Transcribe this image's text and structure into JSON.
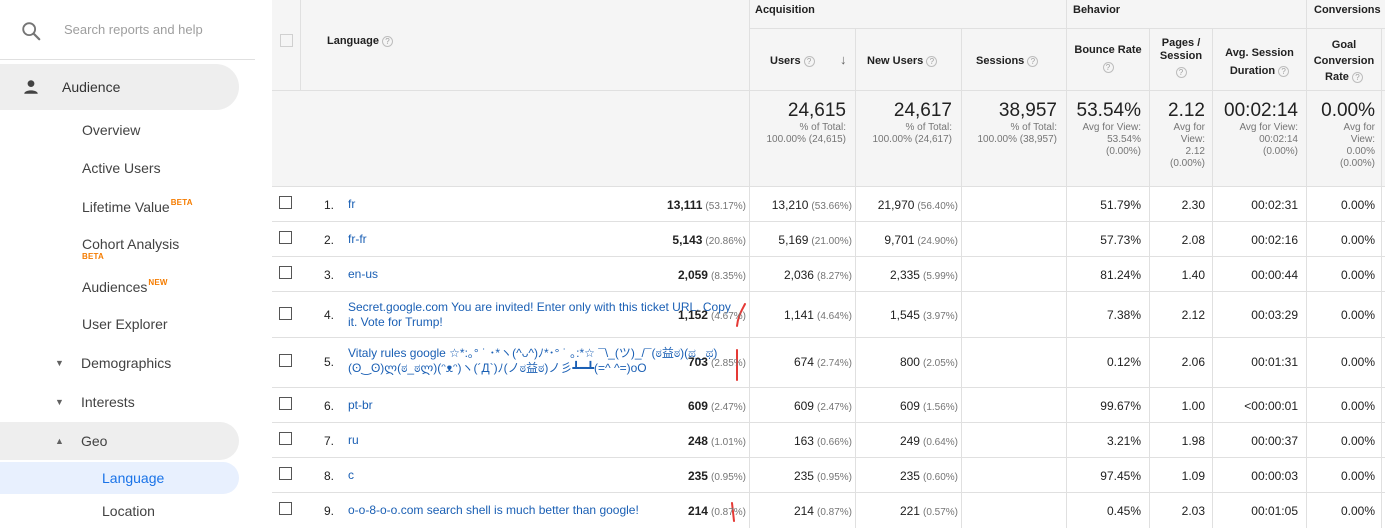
{
  "search": {
    "placeholder": "Search reports and help",
    "icon": "search-icon"
  },
  "sidebar": {
    "audience": "Audience",
    "items": [
      {
        "label": "Overview"
      },
      {
        "label": "Active Users"
      },
      {
        "label": "Lifetime Value",
        "badge": "BETA"
      },
      {
        "label": "Cohort Analysis",
        "badge": "BETA"
      },
      {
        "label": "Audiences",
        "badge": "NEW"
      },
      {
        "label": "User Explorer"
      }
    ],
    "sections": [
      {
        "label": "Demographics",
        "arrow": "▼"
      },
      {
        "label": "Interests",
        "arrow": "▼"
      },
      {
        "label": "Geo",
        "arrow": "▲"
      }
    ],
    "geo_children": [
      {
        "label": "Language",
        "selected": true
      },
      {
        "label": "Location"
      }
    ]
  },
  "table": {
    "groups": {
      "acquisition": "Acquisition",
      "behavior": "Behavior",
      "conversions": "Conversions"
    },
    "headers": {
      "language": "Language",
      "users": "Users",
      "new_users": "New Users",
      "sessions": "Sessions",
      "bounce_rate": "Bounce Rate",
      "pages_session_1": "Pages /",
      "pages_session_2": "Session",
      "avg_duration_1": "Avg. Session",
      "avg_duration_2": "Duration",
      "goal_1": "Goal",
      "goal_2": "Conversion",
      "goal_3": "Rate",
      "help": "?",
      "sort_arrow": "↓"
    },
    "totals": {
      "users": {
        "value": "24,615",
        "l1": "% of Total:",
        "l2": "100.00% (24,615)"
      },
      "new_users": {
        "value": "24,617",
        "l1": "% of Total:",
        "l2": "100.00% (24,617)"
      },
      "sessions": {
        "value": "38,957",
        "l1": "% of Total:",
        "l2": "100.00% (38,957)"
      },
      "bounce_rate": {
        "value": "53.54%",
        "l1": "Avg for View:",
        "l2": "53.54%",
        "l3": "(0.00%)"
      },
      "pages": {
        "value": "2.12",
        "l1": "Avg for",
        "l2": "View:",
        "l3": "2.12",
        "l4": "(0.00%)"
      },
      "duration": {
        "value": "00:02:14",
        "l1": "Avg for View:",
        "l2": "00:02:14",
        "l3": "(0.00%)"
      },
      "goal": {
        "value": "0.00%",
        "l1": "Avg for",
        "l2": "View:",
        "l3": "0.00%",
        "l4": "(0.00%)"
      }
    },
    "rows": [
      {
        "n": "1.",
        "lang": "fr",
        "users": "13,111",
        "users_pct": "(53.17%)",
        "new": "13,210",
        "new_pct": "(53.66%)",
        "sessions": "21,970",
        "sessions_pct": "(56.40%)",
        "bounce": "51.79%",
        "pages": "2.30",
        "dur": "00:02:31",
        "goal": "0.00%"
      },
      {
        "n": "2.",
        "lang": "fr-fr",
        "users": "5,143",
        "users_pct": "(20.86%)",
        "new": "5,169",
        "new_pct": "(21.00%)",
        "sessions": "9,701",
        "sessions_pct": "(24.90%)",
        "bounce": "57.73%",
        "pages": "2.08",
        "dur": "00:02:16",
        "goal": "0.00%"
      },
      {
        "n": "3.",
        "lang": "en-us",
        "users": "2,059",
        "users_pct": "(8.35%)",
        "new": "2,036",
        "new_pct": "(8.27%)",
        "sessions": "2,335",
        "sessions_pct": "(5.99%)",
        "bounce": "81.24%",
        "pages": "1.40",
        "dur": "00:00:44",
        "goal": "0.00%"
      },
      {
        "n": "4.",
        "lang": "Secret.google.com You are invited! Enter only with this ticket URL. Copy it. Vote for Trump!",
        "users": "1,152",
        "users_pct": "(4.67%)",
        "new": "1,141",
        "new_pct": "(4.64%)",
        "sessions": "1,545",
        "sessions_pct": "(3.97%)",
        "bounce": "7.38%",
        "pages": "2.12",
        "dur": "00:03:29",
        "goal": "0.00%"
      },
      {
        "n": "5.",
        "lang": "Vitaly rules google ☆*:｡° ˙ ･*ヽ(^ᴗ^)ﾉ*･° ˙ ｡:*☆ ¯\\_(ツ)_/¯(ಠ益ಠ)(ಥ‿ಥ)(ʘ‿ʘ)ლ(ಠ_ಠლ)(ᵔᴥᵔ)ヽ(´Д`)ﾉ(ノಠ益ಠ)ノ彡┻━┻(=^ ^=)oO",
        "users": "703",
        "users_pct": "(2.85%)",
        "new": "674",
        "new_pct": "(2.74%)",
        "sessions": "800",
        "sessions_pct": "(2.05%)",
        "bounce": "0.12%",
        "pages": "2.06",
        "dur": "00:01:31",
        "goal": "0.00%"
      },
      {
        "n": "6.",
        "lang": "pt-br",
        "users": "609",
        "users_pct": "(2.47%)",
        "new": "609",
        "new_pct": "(2.47%)",
        "sessions": "609",
        "sessions_pct": "(1.56%)",
        "bounce": "99.67%",
        "pages": "1.00",
        "dur": "<00:00:01",
        "goal": "0.00%"
      },
      {
        "n": "7.",
        "lang": "ru",
        "users": "248",
        "users_pct": "(1.01%)",
        "new": "163",
        "new_pct": "(0.66%)",
        "sessions": "249",
        "sessions_pct": "(0.64%)",
        "bounce": "3.21%",
        "pages": "1.98",
        "dur": "00:00:37",
        "goal": "0.00%"
      },
      {
        "n": "8.",
        "lang": "c",
        "users": "235",
        "users_pct": "(0.95%)",
        "new": "235",
        "new_pct": "(0.95%)",
        "sessions": "235",
        "sessions_pct": "(0.60%)",
        "bounce": "97.45%",
        "pages": "1.09",
        "dur": "00:00:03",
        "goal": "0.00%"
      },
      {
        "n": "9.",
        "lang": "o-o-8-o-o.com search shell is much better than google!",
        "users": "214",
        "users_pct": "(0.87%)",
        "new": "214",
        "new_pct": "(0.87%)",
        "sessions": "221",
        "sessions_pct": "(0.57%)",
        "bounce": "0.45%",
        "pages": "2.03",
        "dur": "00:01:05",
        "goal": "0.00%"
      }
    ]
  },
  "colors": {
    "link": "#1a5fb4",
    "accent": "#1a73e8",
    "badge": "#f57c00",
    "annotation": "#e53935"
  }
}
